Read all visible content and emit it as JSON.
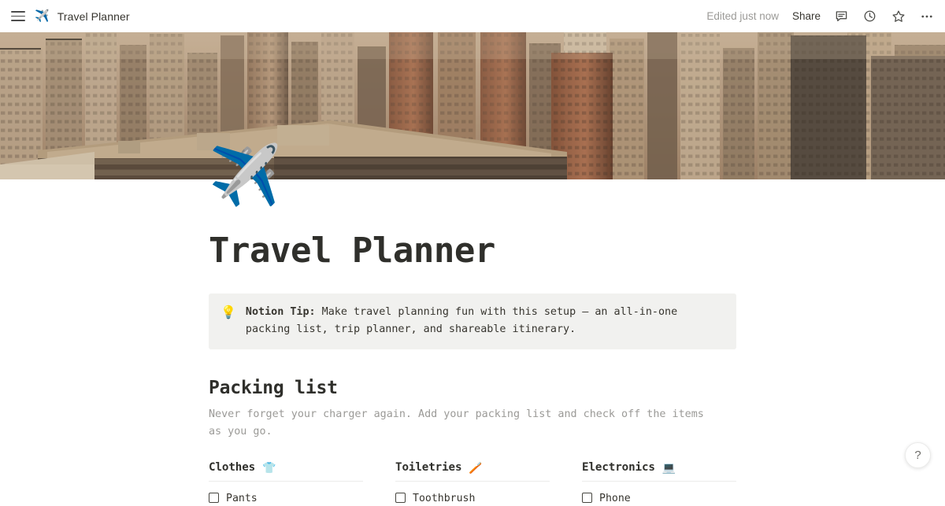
{
  "topbar": {
    "menu_icon": "hamburger-menu-icon",
    "breadcrumb_emoji": "✈️",
    "breadcrumb_title": "Travel Planner",
    "edited_status": "Edited just now",
    "share_label": "Share",
    "icons": [
      "comment-icon",
      "history-clock-icon",
      "star-icon",
      "more-options-icon"
    ]
  },
  "page": {
    "emoji": "✈️",
    "title": "Travel Planner",
    "cover_alt": "aerial-cityscape-cover"
  },
  "callout": {
    "emoji": "💡",
    "bold_label": "Notion Tip:",
    "text": " Make travel planning fun with this setup — an all-in-one packing list, trip planner, and shareable itinerary.",
    "background": "#f1f1ef"
  },
  "packing": {
    "heading": "Packing list",
    "description": "Never forget your charger again. Add your packing list and check off the items as you go.",
    "columns": [
      {
        "label": "Clothes",
        "emoji": "👕",
        "items": [
          {
            "label": "Pants",
            "checked": false
          }
        ]
      },
      {
        "label": "Toiletries",
        "emoji": "🪥",
        "items": [
          {
            "label": "Toothbrush",
            "checked": false
          }
        ]
      },
      {
        "label": "Electronics",
        "emoji": "💻",
        "items": [
          {
            "label": "Phone",
            "checked": false
          }
        ]
      }
    ]
  },
  "help": {
    "label": "?"
  },
  "colors": {
    "text": "#37352f",
    "muted": "#9b9a97",
    "callout_bg": "#f1f1ef",
    "divider": "#ececeb"
  }
}
